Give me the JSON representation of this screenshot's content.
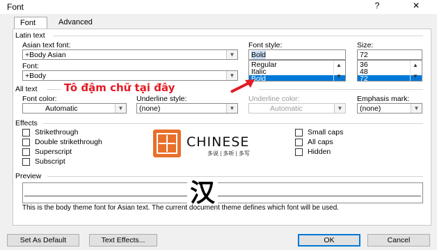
{
  "window": {
    "title": "Font",
    "help_glyph": "?",
    "close_glyph": "✕"
  },
  "tabs": [
    "Font",
    "Advanced"
  ],
  "latin_group": "Latin text",
  "asian_font": {
    "label": "Asian text font:",
    "value": "+Body Asian"
  },
  "font": {
    "label": "Font:",
    "value": "+Body"
  },
  "font_style": {
    "label": "Font style:",
    "value": "Bold",
    "options": [
      "Regular",
      "Italic",
      "Bold"
    ],
    "selected": "Bold"
  },
  "size": {
    "label": "Size:",
    "value": "72",
    "options": [
      "36",
      "48",
      "72"
    ],
    "selected": "72"
  },
  "all_text_group": "All text",
  "font_color": {
    "label": "Font color:",
    "value": "Automatic"
  },
  "underline_style": {
    "label": "Underline style:",
    "value": "(none)"
  },
  "underline_color": {
    "label": "Underline color:",
    "value": "Automatic"
  },
  "emphasis_mark": {
    "label": "Emphasis mark:",
    "value": "(none)"
  },
  "effects_group": "Effects",
  "effects_left": [
    "Strikethrough",
    "Double strikethrough",
    "Superscript",
    "Subscript"
  ],
  "effects_right": [
    "Small caps",
    "All caps",
    "Hidden"
  ],
  "logo": {
    "word": "CHINESE",
    "tagline": "多说 | 多听 | 多写"
  },
  "annotation": "Tô đậm chữ tại đây",
  "preview_group": "Preview",
  "preview_char": "汉",
  "preview_note": "This is the body theme font for Asian text. The current document theme defines which font will be used.",
  "buttons": {
    "set_default": "Set As Default",
    "text_effects": "Text Effects...",
    "ok": "OK",
    "cancel": "Cancel"
  },
  "colors": {
    "accent": "#0078d7",
    "annotation": "#e31b23",
    "logo_orange": "#e8702a"
  }
}
